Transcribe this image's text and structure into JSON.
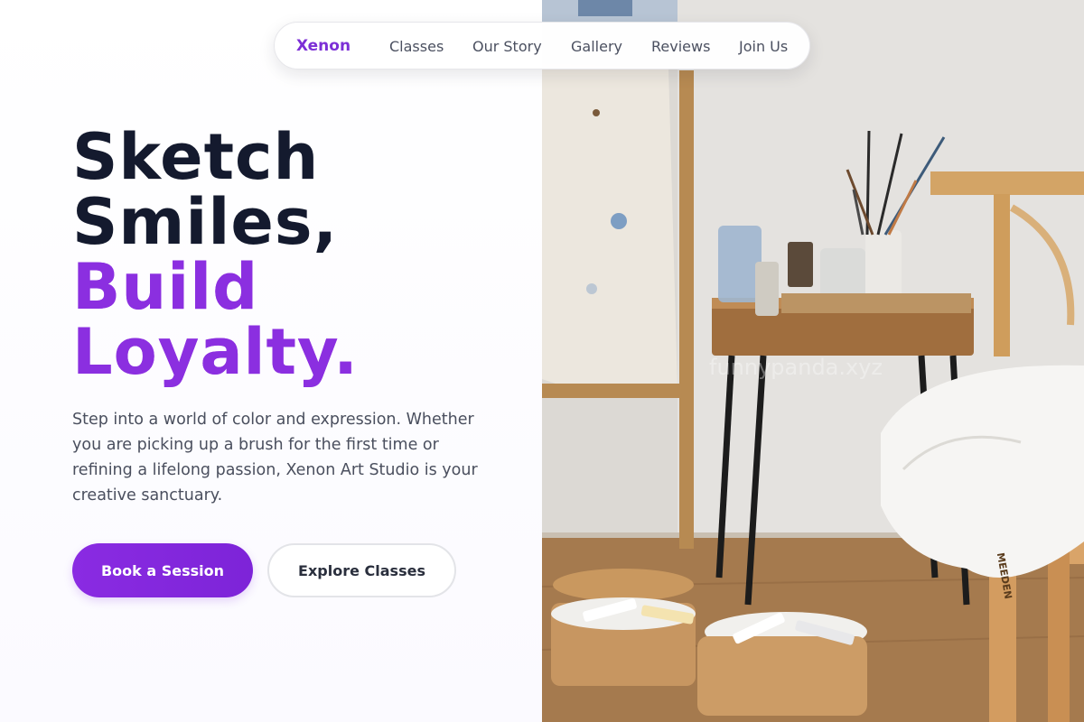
{
  "nav": {
    "brand": "Xenon",
    "links": [
      "Classes",
      "Our Story",
      "Gallery",
      "Reviews",
      "Join Us"
    ]
  },
  "hero": {
    "headline_line1": "Sketch",
    "headline_line2": "Smiles,",
    "headline_accent1": "Build",
    "headline_accent2": "Loyalty.",
    "subtitle": "Step into a world of color and expression. Whether you are picking up a brush for the first time or refining a lifelong passion, Xenon Art Studio is your creative sanctuary.",
    "primary_button": "Book a Session",
    "secondary_button": "Explore Classes"
  },
  "image": {
    "description": "art studio photo with paint brushes, art supplies, and wooden stool",
    "watermark": "funnypanda.xyz",
    "stool_brand": "MEEDEN"
  },
  "colors": {
    "accent": "#8b2fe0",
    "heading": "#141a2e",
    "body_text": "#4a4f5e"
  }
}
